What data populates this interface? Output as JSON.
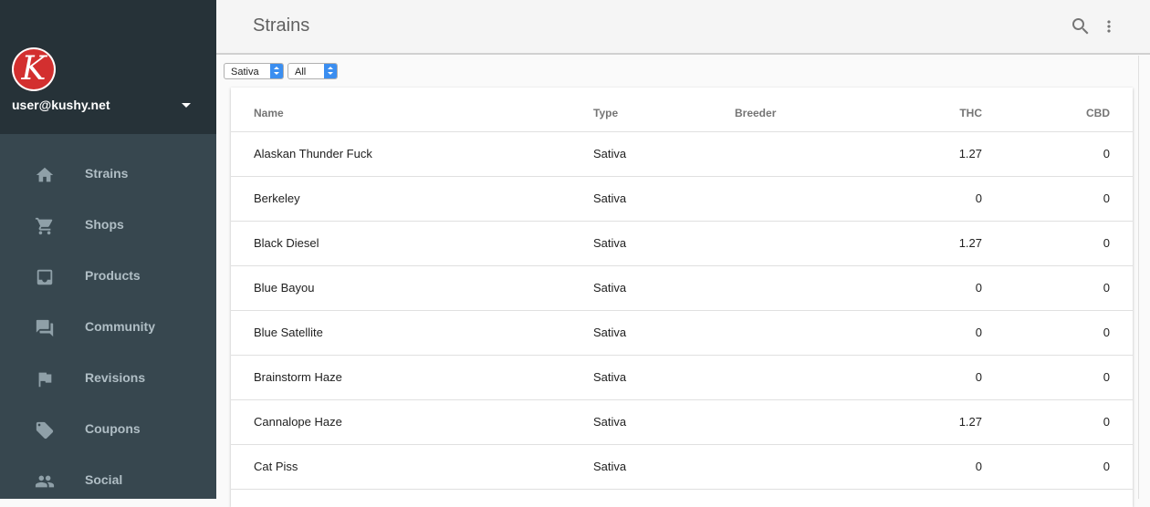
{
  "sidebar": {
    "logo_letter": "K",
    "user_email": "user@kushy.net",
    "items": [
      {
        "label": "Strains",
        "icon": "home-icon"
      },
      {
        "label": "Shops",
        "icon": "cart-icon"
      },
      {
        "label": "Products",
        "icon": "inbox-icon"
      },
      {
        "label": "Community",
        "icon": "forum-icon"
      },
      {
        "label": "Revisions",
        "icon": "flag-icon"
      },
      {
        "label": "Coupons",
        "icon": "tag-icon"
      },
      {
        "label": "Social",
        "icon": "people-icon"
      }
    ]
  },
  "header": {
    "title": "Strains",
    "search_icon": "search-icon",
    "more_icon": "more-vert-icon"
  },
  "filters": {
    "type_value": "Sativa",
    "scope_value": "All"
  },
  "table": {
    "columns": {
      "name": "Name",
      "type": "Type",
      "breeder": "Breeder",
      "thc": "THC",
      "cbd": "CBD"
    },
    "rows": [
      {
        "name": "Alaskan Thunder Fuck",
        "type": "Sativa",
        "breeder": "",
        "thc": "1.27",
        "cbd": "0"
      },
      {
        "name": "Berkeley",
        "type": "Sativa",
        "breeder": "",
        "thc": "0",
        "cbd": "0"
      },
      {
        "name": "Black Diesel",
        "type": "Sativa",
        "breeder": "",
        "thc": "1.27",
        "cbd": "0"
      },
      {
        "name": "Blue Bayou",
        "type": "Sativa",
        "breeder": "",
        "thc": "0",
        "cbd": "0"
      },
      {
        "name": "Blue Satellite",
        "type": "Sativa",
        "breeder": "",
        "thc": "0",
        "cbd": "0"
      },
      {
        "name": "Brainstorm Haze",
        "type": "Sativa",
        "breeder": "",
        "thc": "0",
        "cbd": "0"
      },
      {
        "name": "Cannalope Haze",
        "type": "Sativa",
        "breeder": "",
        "thc": "1.27",
        "cbd": "0"
      },
      {
        "name": "Cat Piss",
        "type": "Sativa",
        "breeder": "",
        "thc": "0",
        "cbd": "0"
      }
    ]
  },
  "colors": {
    "sidebar_bg": "#37474f",
    "sidebar_header_bg": "#263238",
    "logo_red": "#d32f2f",
    "select_accent": "#3b8ef0"
  }
}
